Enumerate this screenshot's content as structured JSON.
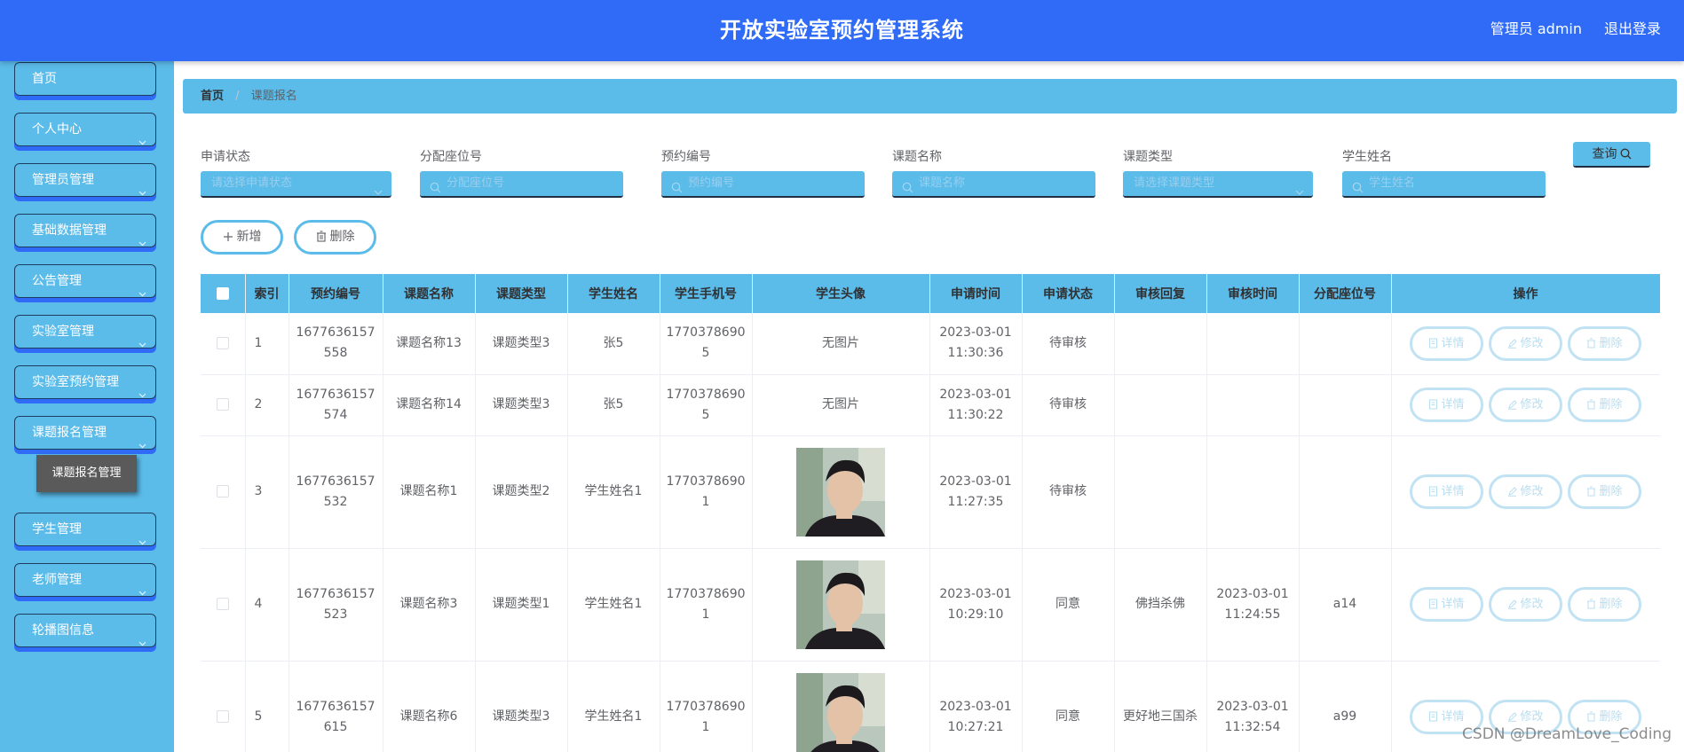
{
  "header": {
    "title": "开放实验室预约管理系统",
    "user": "管理员 admin",
    "logout": "退出登录"
  },
  "sidebar": {
    "items": [
      {
        "label": "首页",
        "has_chevron": false
      },
      {
        "label": "个人中心",
        "has_chevron": true
      },
      {
        "label": "管理员管理",
        "has_chevron": true
      },
      {
        "label": "基础数据管理",
        "has_chevron": true
      },
      {
        "label": "公告管理",
        "has_chevron": true
      },
      {
        "label": "实验室管理",
        "has_chevron": true
      },
      {
        "label": "实验室预约管理",
        "has_chevron": true
      },
      {
        "label": "课题报名管理",
        "has_chevron": true
      },
      {
        "label": "学生管理",
        "has_chevron": true
      },
      {
        "label": "老师管理",
        "has_chevron": true
      },
      {
        "label": "轮播图信息",
        "has_chevron": true
      }
    ],
    "submenu": {
      "label": "课题报名管理"
    }
  },
  "breadcrumb": {
    "home": "首页",
    "separator": "/",
    "current": "课题报名"
  },
  "search": {
    "fields": [
      {
        "label": "申请状态",
        "placeholder": "请选择申请状态",
        "kind": "select"
      },
      {
        "label": "分配座位号",
        "placeholder": "分配座位号",
        "kind": "input"
      },
      {
        "label": "预约编号",
        "placeholder": "预约编号",
        "kind": "input"
      },
      {
        "label": "课题名称",
        "placeholder": "课题名称",
        "kind": "input"
      },
      {
        "label": "课题类型",
        "placeholder": "请选择课题类型",
        "kind": "select"
      },
      {
        "label": "学生姓名",
        "placeholder": "学生姓名",
        "kind": "input"
      }
    ],
    "query_label": "查询"
  },
  "actions": {
    "add_label": "新增",
    "delete_label": "删除"
  },
  "table": {
    "columns": [
      "索引",
      "预约编号",
      "课题名称",
      "课题类型",
      "学生姓名",
      "学生手机号",
      "学生头像",
      "申请时间",
      "申请状态",
      "审核回复",
      "审核时间",
      "分配座位号",
      "操作"
    ],
    "no_image_text": "无图片",
    "op_labels": {
      "detail": "详情",
      "edit": "修改",
      "delete": "删除"
    },
    "rows": [
      {
        "index": "1",
        "booking_no": "1677636157558",
        "topic_name": "课题名称13",
        "topic_type": "课题类型3",
        "student_name": "张5",
        "phone": "17703786905",
        "has_avatar": false,
        "apply_time": "2023-03-01 11:30:36",
        "status": "待审核",
        "reply": "",
        "review_time": "",
        "seat": ""
      },
      {
        "index": "2",
        "booking_no": "1677636157574",
        "topic_name": "课题名称14",
        "topic_type": "课题类型3",
        "student_name": "张5",
        "phone": "17703786905",
        "has_avatar": false,
        "apply_time": "2023-03-01 11:30:22",
        "status": "待审核",
        "reply": "",
        "review_time": "",
        "seat": ""
      },
      {
        "index": "3",
        "booking_no": "1677636157532",
        "topic_name": "课题名称1",
        "topic_type": "课题类型2",
        "student_name": "学生姓名1",
        "phone": "17703786901",
        "has_avatar": true,
        "apply_time": "2023-03-01 11:27:35",
        "status": "待审核",
        "reply": "",
        "review_time": "",
        "seat": ""
      },
      {
        "index": "4",
        "booking_no": "1677636157523",
        "topic_name": "课题名称3",
        "topic_type": "课题类型1",
        "student_name": "学生姓名1",
        "phone": "17703786901",
        "has_avatar": true,
        "apply_time": "2023-03-01 10:29:10",
        "status": "同意",
        "reply": "佛挡杀佛",
        "review_time": "2023-03-01 11:24:55",
        "seat": "a14"
      },
      {
        "index": "5",
        "booking_no": "1677636157615",
        "topic_name": "课题名称6",
        "topic_type": "课题类型3",
        "student_name": "学生姓名1",
        "phone": "17703786901",
        "has_avatar": true,
        "apply_time": "2023-03-01 10:27:21",
        "status": "同意",
        "reply": "更好地三国杀",
        "review_time": "2023-03-01 11:32:54",
        "seat": "a99"
      }
    ]
  },
  "watermark": "CSDN @DreamLove_Coding",
  "colors": {
    "header_blue": "#2f6bf7",
    "sky_blue": "#5bbbe9",
    "submenu_gray": "#5a5a5a"
  }
}
